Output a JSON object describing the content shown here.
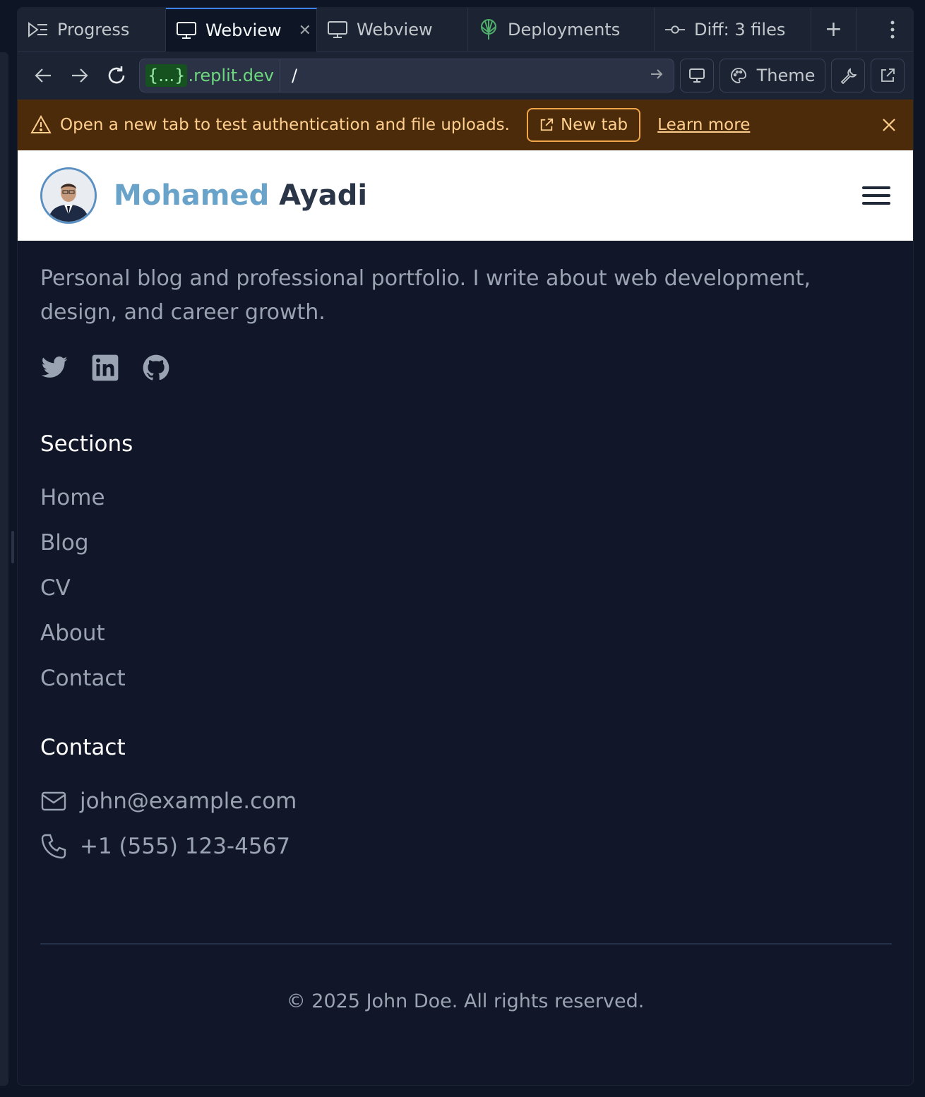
{
  "tabs": [
    {
      "label": "Progress",
      "icon": "progress-icon"
    },
    {
      "label": "Webview",
      "icon": "monitor-icon",
      "active": true
    },
    {
      "label": "Webview",
      "icon": "monitor-icon"
    },
    {
      "label": "Deployments",
      "icon": "deploy-icon"
    },
    {
      "label": "Diff: 3 files",
      "icon": "commit-icon"
    }
  ],
  "address": {
    "braces": "{...}",
    "host": ".replit.dev",
    "path": "/"
  },
  "toolbar": {
    "theme_label": "Theme"
  },
  "banner": {
    "message": "Open a new tab to test authentication and file uploads.",
    "new_tab_label": "New tab",
    "learn_more_label": "Learn more"
  },
  "site": {
    "first_name": "Mohamed",
    "last_name": "Ayadi",
    "description": "Personal blog and professional portfolio. I write about web development, design, and career growth.",
    "sections_title": "Sections",
    "sections": [
      "Home",
      "Blog",
      "CV",
      "About",
      "Contact"
    ],
    "contact_title": "Contact",
    "email": "john@example.com",
    "phone": "+1 (555) 123-4567",
    "copyright": "© 2025 John Doe. All rights reserved."
  },
  "colors": {
    "background": "#111729",
    "banner": "#4c2b0a",
    "brand_first": "#6aa3c9",
    "brand_last": "#2b3548",
    "accent_tab": "#3b82f6"
  }
}
